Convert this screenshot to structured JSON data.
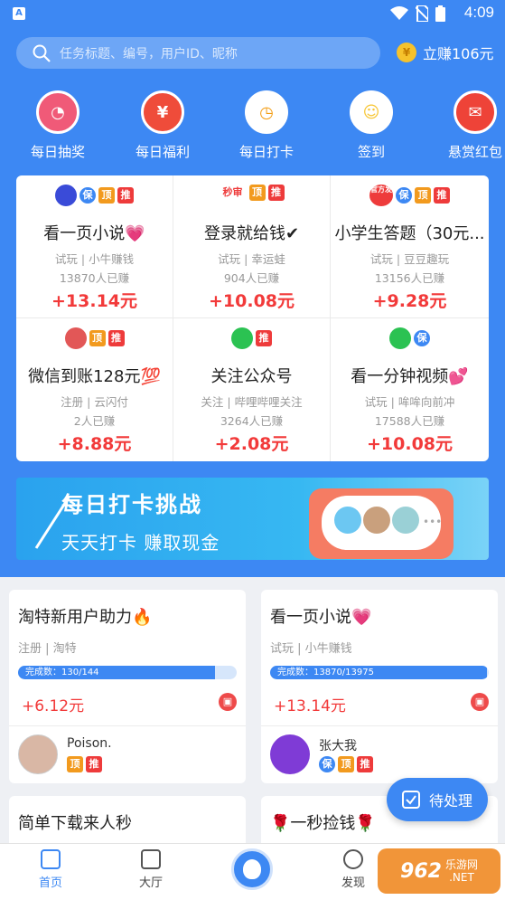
{
  "status": {
    "time": "4:09",
    "app_badge": "A"
  },
  "search": {
    "placeholder": "任务标题、编号，用户ID、昵称"
  },
  "earn": {
    "label": "立赚106元",
    "coin": "¥"
  },
  "quick": [
    {
      "label": "每日抽奖",
      "color": "#f05a78"
    },
    {
      "label": "每日福利",
      "color": "#ef4c3a"
    },
    {
      "label": "每日打卡",
      "color": "#f39c12"
    },
    {
      "label": "签到",
      "color": "#f7c531"
    },
    {
      "label": "悬赏红包",
      "color": "#ee4338"
    }
  ],
  "tasks_grid": [
    {
      "title": "看一页小说💗",
      "sub": "试玩 | 小牛赚钱",
      "count": "13870人已赚",
      "price": "+13.14元"
    },
    {
      "title": "登录就给钱✔",
      "sub": "试玩 | 幸运蛙",
      "count": "904人已赚",
      "price": "+10.08元"
    },
    {
      "title": "小学生答题（30元...",
      "sub": "试玩 | 豆豆趣玩",
      "count": "13156人已赚",
      "price": "+9.28元"
    },
    {
      "title": "微信到账128元💯",
      "sub": "注册 | 云闪付",
      "count": "2人已赚",
      "price": "+8.88元"
    },
    {
      "title": "关注公众号",
      "sub": "关注 | 哔哩哔哩关注",
      "count": "3264人已赚",
      "price": "+2.08元"
    },
    {
      "title": "看一分钟视频💕",
      "sub": "试玩 | 哞哞向前冲",
      "count": "17588人已赚",
      "price": "+10.08元"
    }
  ],
  "badges": {
    "bao": "保",
    "ding": "顶",
    "tui": "推",
    "miao": "秒审",
    "guanfang": "官方发"
  },
  "banner": {
    "title": "每日打卡挑战",
    "subtitle": "天天打卡 赚取现金"
  },
  "task_cards": [
    {
      "title": "淘特新用户助力🔥",
      "sub": "注册 | 淘特",
      "progress_label": "完成数：130/144",
      "progress": 0.9,
      "price": "+6.12元",
      "user": "Poison."
    },
    {
      "title": "看一页小说💗",
      "sub": "试玩 | 小牛赚钱",
      "progress_label": "完成数：13870/13975",
      "progress": 0.99,
      "price": "+13.14元",
      "user": "张大我"
    },
    {
      "title": "简单下载来人秒"
    },
    {
      "title": "🌹一秒捡钱🌹"
    }
  ],
  "pending": {
    "label": "待处理"
  },
  "tabs": [
    {
      "label": "首页"
    },
    {
      "label": "大厅"
    },
    {
      "label": "发现"
    }
  ],
  "watermark": {
    "text": "962",
    "sub": "乐游网",
    "domain": ".NET"
  },
  "colors": {
    "primary": "#3d88f3",
    "price": "#f23a3a"
  }
}
